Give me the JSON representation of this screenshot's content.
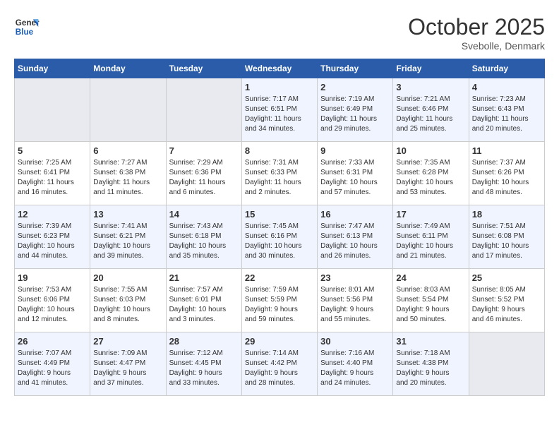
{
  "header": {
    "logo_line1": "General",
    "logo_line2": "Blue",
    "month": "October 2025",
    "location": "Svebolle, Denmark"
  },
  "days_of_week": [
    "Sunday",
    "Monday",
    "Tuesday",
    "Wednesday",
    "Thursday",
    "Friday",
    "Saturday"
  ],
  "weeks": [
    [
      {
        "day": "",
        "info": ""
      },
      {
        "day": "",
        "info": ""
      },
      {
        "day": "",
        "info": ""
      },
      {
        "day": "1",
        "info": "Sunrise: 7:17 AM\nSunset: 6:51 PM\nDaylight: 11 hours\nand 34 minutes."
      },
      {
        "day": "2",
        "info": "Sunrise: 7:19 AM\nSunset: 6:49 PM\nDaylight: 11 hours\nand 29 minutes."
      },
      {
        "day": "3",
        "info": "Sunrise: 7:21 AM\nSunset: 6:46 PM\nDaylight: 11 hours\nand 25 minutes."
      },
      {
        "day": "4",
        "info": "Sunrise: 7:23 AM\nSunset: 6:43 PM\nDaylight: 11 hours\nand 20 minutes."
      }
    ],
    [
      {
        "day": "5",
        "info": "Sunrise: 7:25 AM\nSunset: 6:41 PM\nDaylight: 11 hours\nand 16 minutes."
      },
      {
        "day": "6",
        "info": "Sunrise: 7:27 AM\nSunset: 6:38 PM\nDaylight: 11 hours\nand 11 minutes."
      },
      {
        "day": "7",
        "info": "Sunrise: 7:29 AM\nSunset: 6:36 PM\nDaylight: 11 hours\nand 6 minutes."
      },
      {
        "day": "8",
        "info": "Sunrise: 7:31 AM\nSunset: 6:33 PM\nDaylight: 11 hours\nand 2 minutes."
      },
      {
        "day": "9",
        "info": "Sunrise: 7:33 AM\nSunset: 6:31 PM\nDaylight: 10 hours\nand 57 minutes."
      },
      {
        "day": "10",
        "info": "Sunrise: 7:35 AM\nSunset: 6:28 PM\nDaylight: 10 hours\nand 53 minutes."
      },
      {
        "day": "11",
        "info": "Sunrise: 7:37 AM\nSunset: 6:26 PM\nDaylight: 10 hours\nand 48 minutes."
      }
    ],
    [
      {
        "day": "12",
        "info": "Sunrise: 7:39 AM\nSunset: 6:23 PM\nDaylight: 10 hours\nand 44 minutes."
      },
      {
        "day": "13",
        "info": "Sunrise: 7:41 AM\nSunset: 6:21 PM\nDaylight: 10 hours\nand 39 minutes."
      },
      {
        "day": "14",
        "info": "Sunrise: 7:43 AM\nSunset: 6:18 PM\nDaylight: 10 hours\nand 35 minutes."
      },
      {
        "day": "15",
        "info": "Sunrise: 7:45 AM\nSunset: 6:16 PM\nDaylight: 10 hours\nand 30 minutes."
      },
      {
        "day": "16",
        "info": "Sunrise: 7:47 AM\nSunset: 6:13 PM\nDaylight: 10 hours\nand 26 minutes."
      },
      {
        "day": "17",
        "info": "Sunrise: 7:49 AM\nSunset: 6:11 PM\nDaylight: 10 hours\nand 21 minutes."
      },
      {
        "day": "18",
        "info": "Sunrise: 7:51 AM\nSunset: 6:08 PM\nDaylight: 10 hours\nand 17 minutes."
      }
    ],
    [
      {
        "day": "19",
        "info": "Sunrise: 7:53 AM\nSunset: 6:06 PM\nDaylight: 10 hours\nand 12 minutes."
      },
      {
        "day": "20",
        "info": "Sunrise: 7:55 AM\nSunset: 6:03 PM\nDaylight: 10 hours\nand 8 minutes."
      },
      {
        "day": "21",
        "info": "Sunrise: 7:57 AM\nSunset: 6:01 PM\nDaylight: 10 hours\nand 3 minutes."
      },
      {
        "day": "22",
        "info": "Sunrise: 7:59 AM\nSunset: 5:59 PM\nDaylight: 9 hours\nand 59 minutes."
      },
      {
        "day": "23",
        "info": "Sunrise: 8:01 AM\nSunset: 5:56 PM\nDaylight: 9 hours\nand 55 minutes."
      },
      {
        "day": "24",
        "info": "Sunrise: 8:03 AM\nSunset: 5:54 PM\nDaylight: 9 hours\nand 50 minutes."
      },
      {
        "day": "25",
        "info": "Sunrise: 8:05 AM\nSunset: 5:52 PM\nDaylight: 9 hours\nand 46 minutes."
      }
    ],
    [
      {
        "day": "26",
        "info": "Sunrise: 7:07 AM\nSunset: 4:49 PM\nDaylight: 9 hours\nand 41 minutes."
      },
      {
        "day": "27",
        "info": "Sunrise: 7:09 AM\nSunset: 4:47 PM\nDaylight: 9 hours\nand 37 minutes."
      },
      {
        "day": "28",
        "info": "Sunrise: 7:12 AM\nSunset: 4:45 PM\nDaylight: 9 hours\nand 33 minutes."
      },
      {
        "day": "29",
        "info": "Sunrise: 7:14 AM\nSunset: 4:42 PM\nDaylight: 9 hours\nand 28 minutes."
      },
      {
        "day": "30",
        "info": "Sunrise: 7:16 AM\nSunset: 4:40 PM\nDaylight: 9 hours\nand 24 minutes."
      },
      {
        "day": "31",
        "info": "Sunrise: 7:18 AM\nSunset: 4:38 PM\nDaylight: 9 hours\nand 20 minutes."
      },
      {
        "day": "",
        "info": ""
      }
    ]
  ]
}
